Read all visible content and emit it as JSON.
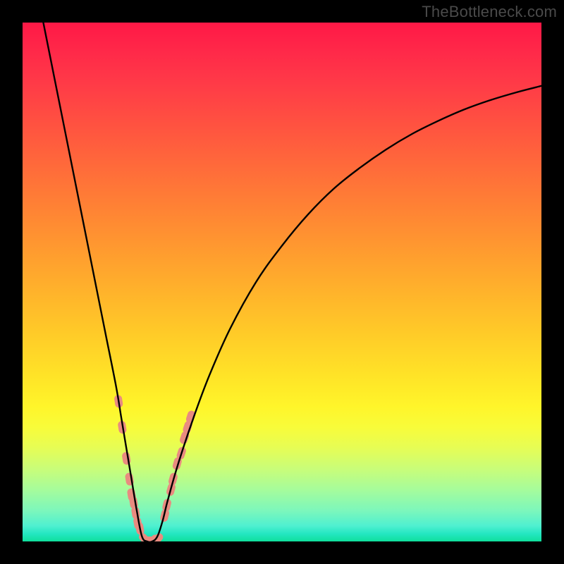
{
  "watermark": "TheBottleneck.com",
  "chart_data": {
    "type": "line",
    "title": "",
    "xlabel": "",
    "ylabel": "",
    "xlim": [
      0,
      100
    ],
    "ylim": [
      0,
      100
    ],
    "grid": false,
    "legend": false,
    "series": [
      {
        "name": "bottleneck-curve",
        "x": [
          4,
          6,
          8,
          10,
          12,
          14,
          16,
          18,
          19,
          20,
          21,
          22,
          23,
          24,
          25,
          26,
          27,
          28,
          30,
          33,
          36,
          40,
          45,
          50,
          55,
          60,
          65,
          70,
          75,
          80,
          85,
          90,
          95,
          100
        ],
        "y": [
          100,
          90,
          80,
          70,
          60,
          50,
          40,
          30,
          24,
          18,
          12,
          6,
          1,
          0,
          0,
          1,
          4,
          8,
          15,
          24,
          32,
          41,
          50,
          57,
          63,
          68,
          72,
          75.5,
          78.5,
          81,
          83.2,
          85,
          86.5,
          87.8
        ]
      }
    ],
    "markers": [
      {
        "name": "highlight-point",
        "x": 18.5,
        "y": 27
      },
      {
        "name": "highlight-point",
        "x": 19.2,
        "y": 22
      },
      {
        "name": "highlight-point",
        "x": 20.0,
        "y": 16
      },
      {
        "name": "highlight-point",
        "x": 20.6,
        "y": 12
      },
      {
        "name": "highlight-point",
        "x": 21.0,
        "y": 9
      },
      {
        "name": "highlight-point",
        "x": 21.4,
        "y": 7.5
      },
      {
        "name": "highlight-point",
        "x": 21.8,
        "y": 5.5
      },
      {
        "name": "highlight-point",
        "x": 22.2,
        "y": 3.5
      },
      {
        "name": "highlight-point",
        "x": 22.6,
        "y": 2.5
      },
      {
        "name": "highlight-point",
        "x": 23.5,
        "y": 0.5
      },
      {
        "name": "highlight-point",
        "x": 24.3,
        "y": 0.2
      },
      {
        "name": "highlight-point",
        "x": 25.2,
        "y": 0.2
      },
      {
        "name": "highlight-point",
        "x": 26.0,
        "y": 0.5
      },
      {
        "name": "highlight-point",
        "x": 27.4,
        "y": 5
      },
      {
        "name": "highlight-point",
        "x": 27.8,
        "y": 7
      },
      {
        "name": "highlight-point",
        "x": 28.6,
        "y": 10
      },
      {
        "name": "highlight-point",
        "x": 29.0,
        "y": 12
      },
      {
        "name": "highlight-point",
        "x": 29.8,
        "y": 15
      },
      {
        "name": "highlight-point",
        "x": 30.6,
        "y": 17
      },
      {
        "name": "highlight-point",
        "x": 31.2,
        "y": 20
      },
      {
        "name": "highlight-point",
        "x": 31.8,
        "y": 22
      },
      {
        "name": "highlight-point",
        "x": 32.4,
        "y": 24
      }
    ],
    "background_gradient": {
      "top": "#ff1846",
      "middle": "#ffe327",
      "bottom": "#0fdf9c"
    }
  }
}
